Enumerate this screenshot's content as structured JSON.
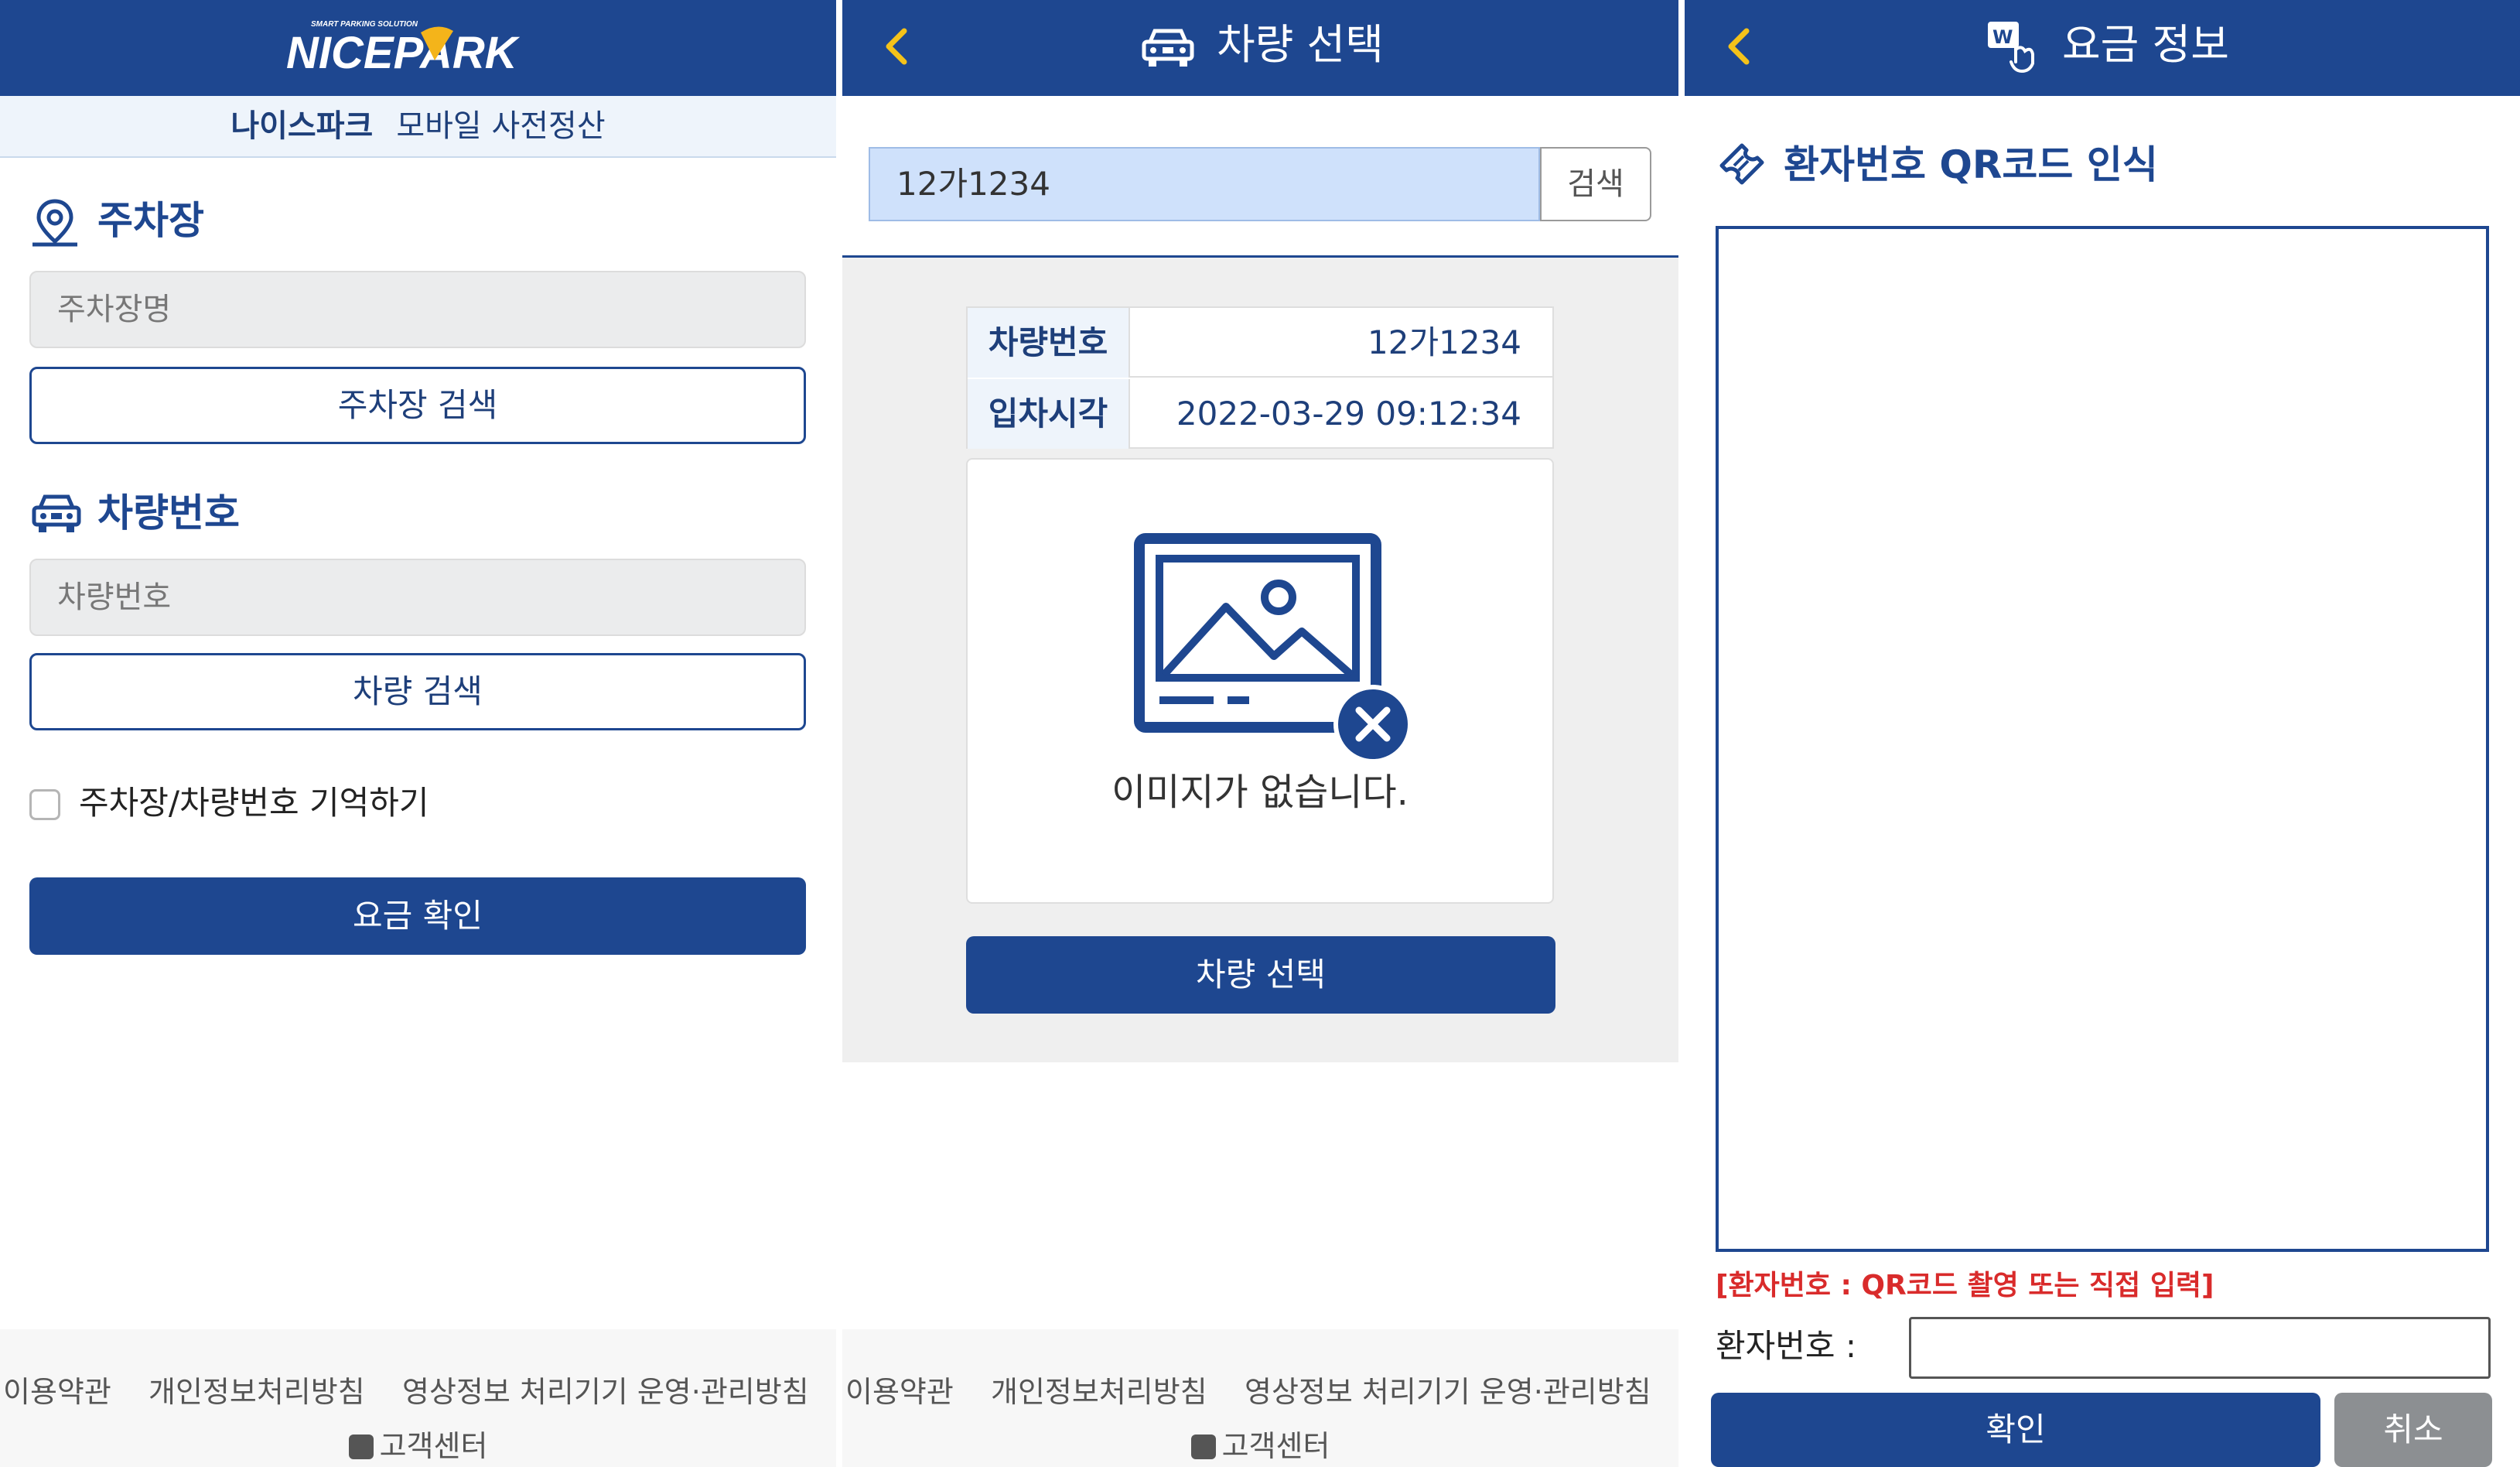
{
  "colors": {
    "primary": "#1e4790",
    "light_panel": "#eef4fb",
    "input_highlight": "#cfe1fb",
    "alert": "#d92b2b",
    "cancel": "#8c8f92"
  },
  "panel1": {
    "logo": {
      "tagline": "SMART PARKING SOLUTION",
      "text": "NICEPARK"
    },
    "subbar": {
      "brand": "나이스파크",
      "text": "모바일 사전정산"
    },
    "parking": {
      "icon": "location-pin-icon",
      "title": "주차장",
      "placeholder": "주차장명",
      "search_label": "주차장 검색"
    },
    "vehicle": {
      "icon": "car-icon",
      "title": "차량번호",
      "placeholder": "차량번호",
      "search_label": "차량 검색"
    },
    "remember_label": "주차장/차량번호 기억하기",
    "remember_checked": false,
    "confirm_label": "요금 확인"
  },
  "panel2": {
    "header": {
      "icon": "car-icon",
      "title": "차량 선택"
    },
    "search": {
      "value": "12가1234",
      "button_label": "검색"
    },
    "info": [
      {
        "key": "차량번호",
        "value": "12가1234"
      },
      {
        "key": "입차시각",
        "value": "2022-03-29 09:12:34"
      }
    ],
    "no_image_text": "이미지가 없습니다.",
    "no_image_icon": "image-missing-icon",
    "select_label": "차량 선택"
  },
  "panel3": {
    "header": {
      "icon": "web-touch-icon",
      "title": "요금 정보"
    },
    "qr_title": "환자번호 QR코드 인식",
    "qr_icon": "ticket-icon",
    "note": "[환자번호 : QR코드 촬영 또는 직접 입력]",
    "patient_label": "환자번호 :",
    "patient_value": "",
    "confirm_label": "확인",
    "cancel_label": "취소"
  },
  "footer": {
    "links": [
      "이용약관",
      "개인정보처리방침",
      "영상정보 처리기기 운영·관리방침"
    ],
    "customer_center": "고객센터"
  }
}
